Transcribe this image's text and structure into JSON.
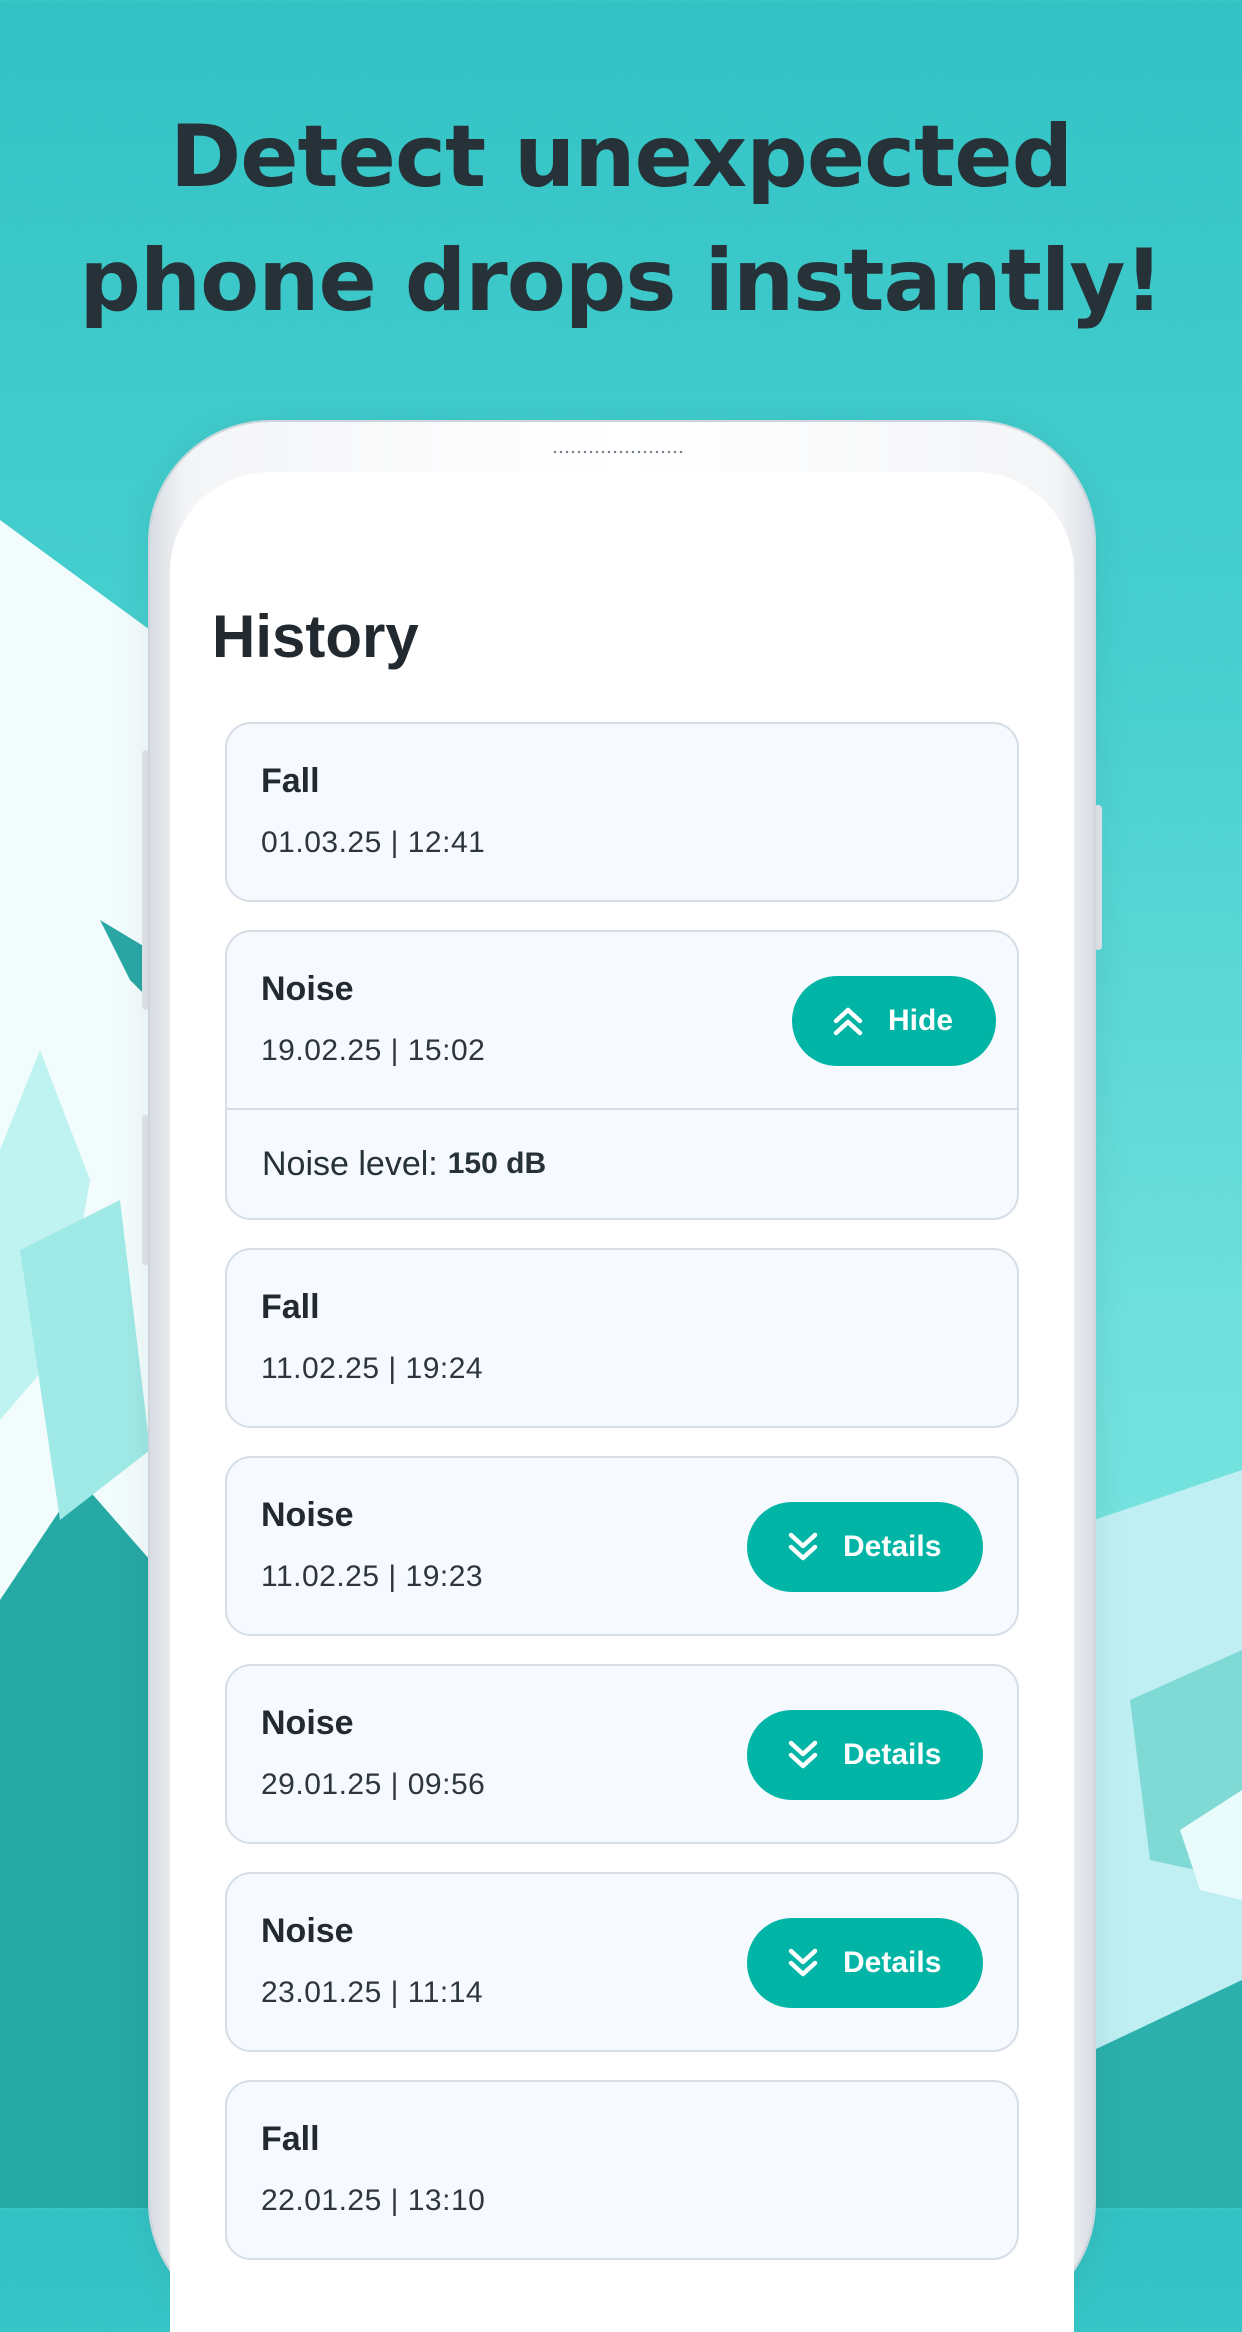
{
  "headline": {
    "line1": "Detect unexpected",
    "line2": "phone drops instantly!"
  },
  "screen": {
    "title": "History"
  },
  "events": [
    {
      "type": "Fall",
      "date": "01.03.25 | 12:41",
      "button": null
    },
    {
      "type": "Noise",
      "date": "19.02.25 | 15:02",
      "button": "Hide",
      "expanded": true,
      "detail_label": "Noise level:",
      "detail_value": "150 dB"
    },
    {
      "type": "Fall",
      "date": "11.02.25 | 19:24",
      "button": null
    },
    {
      "type": "Noise",
      "date": "11.02.25 | 19:23",
      "button": "Details"
    },
    {
      "type": "Noise",
      "date": "29.01.25 | 09:56",
      "button": "Details"
    },
    {
      "type": "Noise",
      "date": "23.01.25 | 11:14",
      "button": "Details"
    },
    {
      "type": "Fall",
      "date": "22.01.25 | 13:10",
      "button": null
    }
  ],
  "icons": {
    "expand": "chevrons-down-icon",
    "collapse": "chevrons-up-icon"
  },
  "colors": {
    "background": "#3cc6c7",
    "accent_button": "#00b5a6",
    "headline_text": "#263238",
    "card_background": "#f6f9fd",
    "card_border": "#d5dde6"
  }
}
